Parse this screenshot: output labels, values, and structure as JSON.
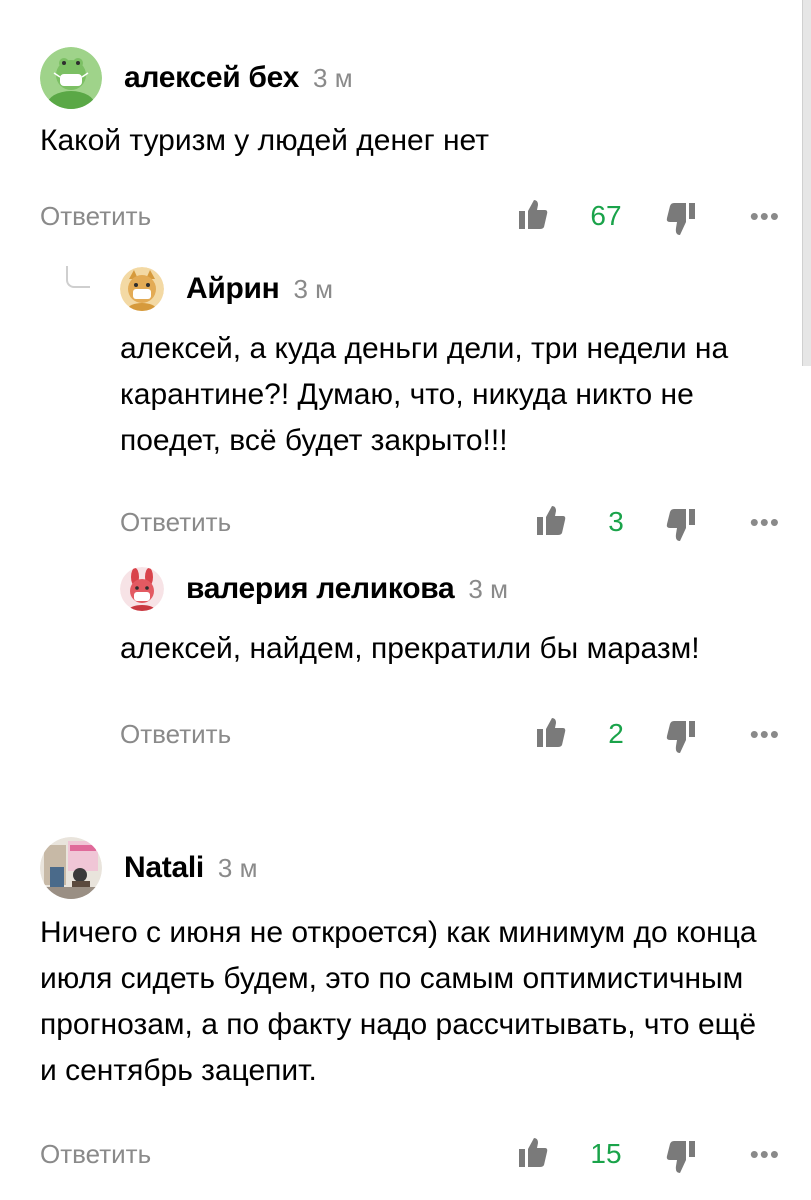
{
  "colors": {
    "like_count": "#1aa34a",
    "secondary_text": "#8a8a8a",
    "text": "#000000"
  },
  "comments": [
    {
      "author": "алексей бех",
      "time": "3 м",
      "text": "Какой туризм у людей денег нет",
      "reply_label": "Ответить",
      "likes": "67",
      "more_label": "•••",
      "avatar_icon": "frog-mask-avatar"
    },
    {
      "author": "Айрин",
      "time": "3 м",
      "text": "алексей, а куда деньги дели, три недели на карантине?! Думаю, что, никуда никто не поедет, всё будет закрыто!!!",
      "reply_label": "Ответить",
      "likes": "3",
      "more_label": "•••",
      "avatar_icon": "cat-mask-avatar"
    },
    {
      "author": "валерия леликова",
      "time": "3 м",
      "text": "алексей, найдем, прекратили бы маразм!",
      "reply_label": "Ответить",
      "likes": "2",
      "more_label": "•••",
      "avatar_icon": "bunny-mask-avatar"
    },
    {
      "author": "Natali",
      "time": "3 м",
      "text": "Ничего с июня не откроется) как минимум до конца июля сидеть будем, это по самым оптимистичным прогнозам, а по факту надо рассчитывать, что ещё и сентябрь зацепит.",
      "reply_label": "Ответить",
      "likes": "15",
      "more_label": "•••",
      "avatar_icon": "photo-avatar"
    }
  ]
}
